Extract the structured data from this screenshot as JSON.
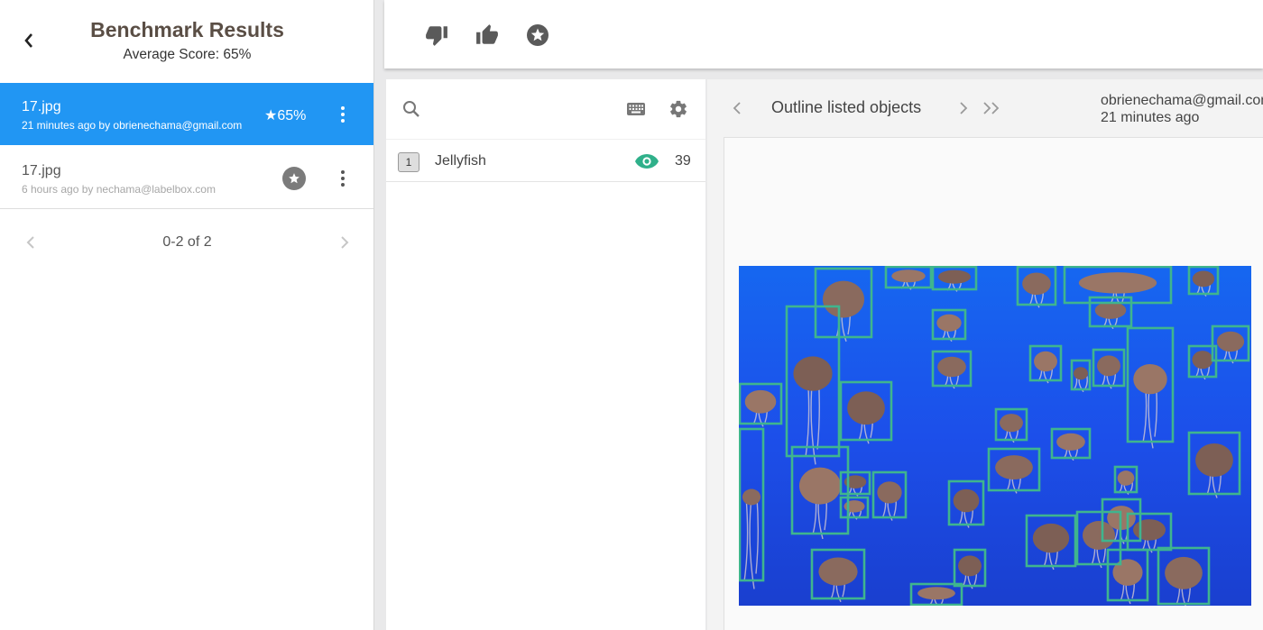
{
  "left_panel": {
    "title": "Benchmark Results",
    "subtitle": "Average Score: 65%",
    "rows": [
      {
        "file": "17.jpg",
        "meta": "21 minutes ago by obrienechama@gmail.com",
        "score": "★65%"
      },
      {
        "file": "17.jpg",
        "meta": "6 hours ago by nechama@labelbox.com"
      }
    ],
    "pagination": "0-2 of 2"
  },
  "toolbar": {
    "icons": [
      "thumbs-down-icon",
      "thumbs-up-icon",
      "star-circle-icon"
    ]
  },
  "tools": {
    "objects": [
      {
        "key": "1",
        "name": "Jellyfish",
        "count": "39"
      }
    ]
  },
  "work": {
    "task": "Outline listed objects",
    "labeler": "obrienechama@gmail.com",
    "time": "21 minutes ago"
  },
  "colors": {
    "selected_row": "#2196f3",
    "box_color": "#3fb58e",
    "ocean": "#1d55e8"
  }
}
